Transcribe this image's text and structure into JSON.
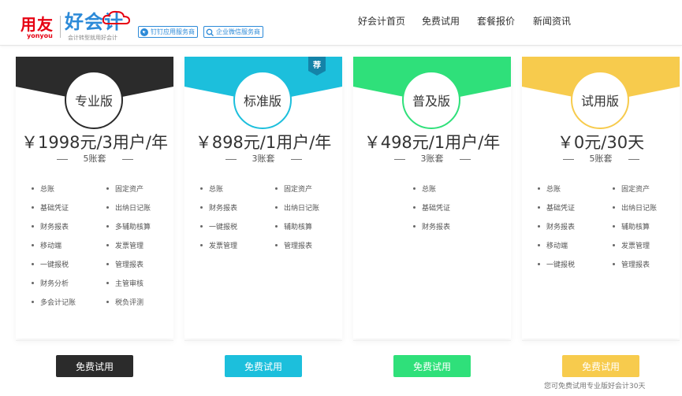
{
  "header": {
    "logo_yonyou": "用友",
    "logo_yonyou_en": "yonyou",
    "logo_main": "好会计",
    "logo_tagline": "会计转型就用好会计",
    "service_buttons": [
      "钉钉应用服务商",
      "企业微信服务商"
    ],
    "nav": [
      "好会计首页",
      "免费试用",
      "套餐报价",
      "新闻资讯"
    ]
  },
  "plans": [
    {
      "name": "专业版",
      "price": "￥1998元/3用户/年",
      "sets": "5账套",
      "color": "#2b2b2b",
      "features_left": [
        "总账",
        "基础凭证",
        "财务报表",
        "移动端",
        "一键报税",
        "财务分析",
        "多会计记账"
      ],
      "features_right": [
        "固定资产",
        "出纳日记账",
        "多辅助核算",
        "发票管理",
        "管理报表",
        "主管审核",
        "税负评测"
      ],
      "button": "免费试用"
    },
    {
      "name": "标准版",
      "price": "￥898元/1用户/年",
      "sets": "3账套",
      "color": "#1cbfdc",
      "recommended": "荐",
      "features_left": [
        "总账",
        "财务报表",
        "一键报税",
        "发票管理"
      ],
      "features_right": [
        "固定资产",
        "出纳日记账",
        "辅助核算",
        "管理报表"
      ],
      "button": "免费试用"
    },
    {
      "name": "普及版",
      "price": "￥498元/1用户/年",
      "sets": "3账套",
      "color": "#2fe07a",
      "features_left": [
        "总账",
        "基础凭证",
        "财务报表"
      ],
      "features_right": [],
      "button": "免费试用"
    },
    {
      "name": "试用版",
      "price": "￥0元/30天",
      "sets": "5账套",
      "color": "#f7cb4d",
      "features_left": [
        "总账",
        "基础凭证",
        "财务报表",
        "移动端",
        "一键报税"
      ],
      "features_right": [
        "固定资产",
        "出纳日记账",
        "辅助核算",
        "发票管理",
        "管理报表"
      ],
      "button": "免费试用"
    }
  ],
  "trial_note": "您可免费试用专业版好会计30天"
}
